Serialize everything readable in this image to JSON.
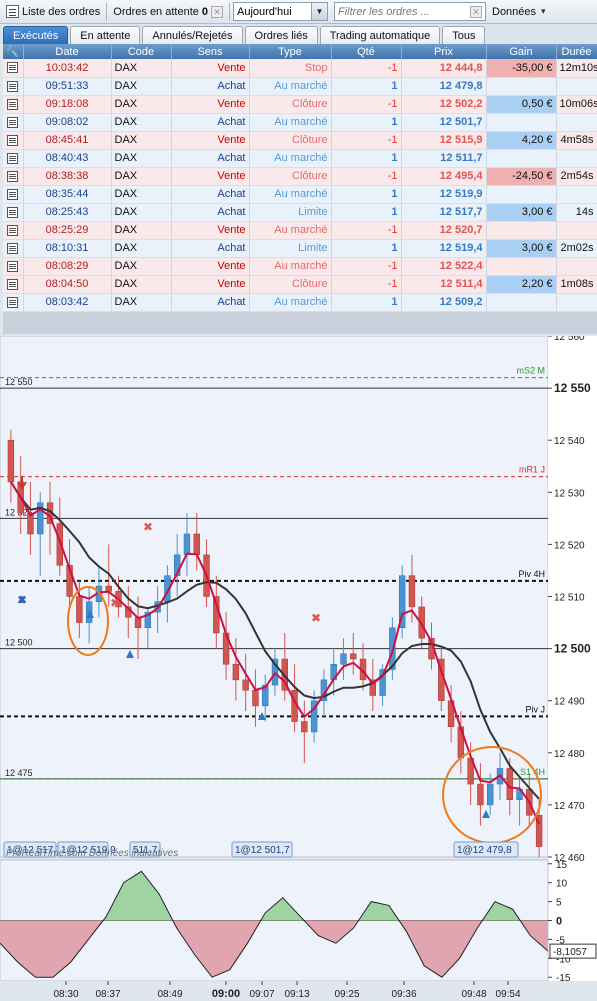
{
  "toolbar": {
    "order_list_label": "Liste des ordres",
    "pending_label": "Ordres en attente",
    "pending_count": "0",
    "period_value": "Aujourd'hui",
    "filter_placeholder": "Filtrer les ordres ...",
    "data_label": "Données"
  },
  "tabs": [
    "Exécutés",
    "En attente",
    "Annulés/Rejetés",
    "Ordres liés",
    "Trading automatique",
    "Tous"
  ],
  "columns": [
    "",
    "Date",
    "Code",
    "Sens",
    "Type",
    "Qté",
    "Prix",
    "Gain",
    "Durée"
  ],
  "orders": [
    {
      "time": "10:03:42",
      "code": "DAX",
      "side": "Vente",
      "type": "Stop",
      "qty": "-1",
      "price": "12 444,8",
      "gain": "-35,00 €",
      "duration": "12m10s",
      "dir": "sell",
      "gain_sign": "neg"
    },
    {
      "time": "09:51:33",
      "code": "DAX",
      "side": "Achat",
      "type": "Au marché",
      "qty": "1",
      "price": "12 479,8",
      "gain": "",
      "duration": "",
      "dir": "buy",
      "gain_sign": ""
    },
    {
      "time": "09:18:08",
      "code": "DAX",
      "side": "Vente",
      "type": "Clôture",
      "qty": "-1",
      "price": "12 502,2",
      "gain": "0,50 €",
      "duration": "10m06s",
      "dir": "sell",
      "gain_sign": "pos"
    },
    {
      "time": "09:08:02",
      "code": "DAX",
      "side": "Achat",
      "type": "Au marché",
      "qty": "1",
      "price": "12 501,7",
      "gain": "",
      "duration": "",
      "dir": "buy",
      "gain_sign": ""
    },
    {
      "time": "08:45:41",
      "code": "DAX",
      "side": "Vente",
      "type": "Clôture",
      "qty": "-1",
      "price": "12 515,9",
      "gain": "4,20 €",
      "duration": "4m58s",
      "dir": "sell",
      "gain_sign": "pos"
    },
    {
      "time": "08:40:43",
      "code": "DAX",
      "side": "Achat",
      "type": "Au marché",
      "qty": "1",
      "price": "12 511,7",
      "gain": "",
      "duration": "",
      "dir": "buy",
      "gain_sign": ""
    },
    {
      "time": "08:38:38",
      "code": "DAX",
      "side": "Vente",
      "type": "Clôture",
      "qty": "-1",
      "price": "12 495,4",
      "gain": "-24,50 €",
      "duration": "2m54s",
      "dir": "sell",
      "gain_sign": "neg"
    },
    {
      "time": "08:35:44",
      "code": "DAX",
      "side": "Achat",
      "type": "Au marché",
      "qty": "1",
      "price": "12 519,9",
      "gain": "",
      "duration": "",
      "dir": "buy",
      "gain_sign": ""
    },
    {
      "time": "08:25:43",
      "code": "DAX",
      "side": "Achat",
      "type": "Limite",
      "qty": "1",
      "price": "12 517,7",
      "gain": "3,00 €",
      "duration": "14s",
      "dir": "buy",
      "gain_sign": "pos"
    },
    {
      "time": "08:25:29",
      "code": "DAX",
      "side": "Vente",
      "type": "Au marché",
      "qty": "-1",
      "price": "12 520,7",
      "gain": "",
      "duration": "",
      "dir": "sell",
      "gain_sign": ""
    },
    {
      "time": "08:10:31",
      "code": "DAX",
      "side": "Achat",
      "type": "Limite",
      "qty": "1",
      "price": "12 519,4",
      "gain": "3,00 €",
      "duration": "2m02s",
      "dir": "buy",
      "gain_sign": "pos"
    },
    {
      "time": "08:08:29",
      "code": "DAX",
      "side": "Vente",
      "type": "Au marché",
      "qty": "-1",
      "price": "12 522,4",
      "gain": "",
      "duration": "",
      "dir": "sell",
      "gain_sign": ""
    },
    {
      "time": "08:04:50",
      "code": "DAX",
      "side": "Vente",
      "type": "Clôture",
      "qty": "-1",
      "price": "12 511,4",
      "gain": "2,20 €",
      "duration": "1m08s",
      "dir": "sell",
      "gain_sign": "pos"
    },
    {
      "time": "08:03:42",
      "code": "DAX",
      "side": "Achat",
      "type": "Au marché",
      "qty": "1",
      "price": "12 509,2",
      "gain": "",
      "duration": "",
      "dir": "buy",
      "gain_sign": ""
    }
  ],
  "chart_data": {
    "type": "candlestick",
    "ylim": [
      12460,
      12560
    ],
    "y_ticks": [
      "12 560",
      "12 550",
      "12 540",
      "12 530",
      "12 520",
      "12 510",
      "12 500",
      "12 490",
      "12 480",
      "12 470",
      "12 460"
    ],
    "level_lines": [
      {
        "label": "mS2 M",
        "value": 12552,
        "color": "#2a9a2a",
        "style": "dashed"
      },
      {
        "label": "12 550",
        "value": 12550,
        "color": "#333333",
        "style": "solid"
      },
      {
        "label": "mR1 J",
        "value": 12533,
        "color": "#d03030",
        "style": "dashed"
      },
      {
        "label": "12 525",
        "value": 12525,
        "color": "#333333",
        "style": "solid"
      },
      {
        "label": "Piv 4H",
        "value": 12513,
        "color": "#111111",
        "style": "dashed"
      },
      {
        "label": "12 500",
        "value": 12500,
        "color": "#333333",
        "style": "solid"
      },
      {
        "label": "Piv J",
        "value": 12487,
        "color": "#111111",
        "style": "dashed"
      },
      {
        "label": "12 475",
        "value": 12475,
        "color": "#333333",
        "style": "solid"
      },
      {
        "label": "S1 4H",
        "value": 12475,
        "color": "#2a9a2a",
        "style": "dashed"
      }
    ],
    "bold_ticks": [
      "12 550",
      "12 500"
    ],
    "x_ticks": [
      "08:30",
      "08:37",
      "08:49",
      "09:00",
      "09:07",
      "09:13",
      "09:25",
      "09:36",
      "09:48",
      "09:54"
    ],
    "trade_tags": [
      "1@12 517,7",
      "1@12 519,9",
      "511,7",
      "1@12 501,7",
      "1@12 479,8"
    ],
    "watermark": "ProRealTime.com Données indicatives",
    "candles": [
      [
        12540,
        12542,
        12528,
        12532
      ],
      [
        12532,
        12537,
        12522,
        12526
      ],
      [
        12526,
        12532,
        12518,
        12522
      ],
      [
        12522,
        12530,
        12514,
        12528
      ],
      [
        12528,
        12532,
        12518,
        12524
      ],
      [
        12524,
        12529,
        12514,
        12516
      ],
      [
        12516,
        12521,
        12508,
        12510
      ],
      [
        12510,
        12513,
        12502,
        12505
      ],
      [
        12505,
        12512,
        12501,
        12509
      ],
      [
        12509,
        12516,
        12506,
        12512
      ],
      [
        12512,
        12520,
        12508,
        12511
      ],
      [
        12511,
        12514,
        12506,
        12508
      ],
      [
        12508,
        12512,
        12502,
        12506
      ],
      [
        12506,
        12510,
        12498,
        12504
      ],
      [
        12504,
        12508,
        12500,
        12507
      ],
      [
        12507,
        12512,
        12503,
        12509
      ],
      [
        12509,
        12516,
        12505,
        12514
      ],
      [
        12514,
        12522,
        12510,
        12518
      ],
      [
        12518,
        12526,
        12514,
        12522
      ],
      [
        12522,
        12526,
        12515,
        12518
      ],
      [
        12518,
        12521,
        12508,
        12510
      ],
      [
        12510,
        12514,
        12500,
        12503
      ],
      [
        12503,
        12507,
        12494,
        12497
      ],
      [
        12497,
        12502,
        12490,
        12494
      ],
      [
        12494,
        12499,
        12488,
        12492
      ],
      [
        12492,
        12496,
        12485,
        12489
      ],
      [
        12489,
        12495,
        12486,
        12493
      ],
      [
        12493,
        12500,
        12491,
        12498
      ],
      [
        12498,
        12503,
        12490,
        12492
      ],
      [
        12492,
        12497,
        12484,
        12486
      ],
      [
        12486,
        12490,
        12478,
        12484
      ],
      [
        12484,
        12492,
        12482,
        12490
      ],
      [
        12490,
        12496,
        12487,
        12494
      ],
      [
        12494,
        12500,
        12491,
        12497
      ],
      [
        12497,
        12502,
        12494,
        12499
      ],
      [
        12499,
        12503,
        12495,
        12498
      ],
      [
        12498,
        12501,
        12492,
        12494
      ],
      [
        12494,
        12498,
        12488,
        12491
      ],
      [
        12491,
        12497,
        12489,
        12496
      ],
      [
        12496,
        12506,
        12494,
        12504
      ],
      [
        12504,
        12516,
        12502,
        12514
      ],
      [
        12514,
        12518,
        12505,
        12508
      ],
      [
        12508,
        12510,
        12500,
        12502
      ],
      [
        12502,
        12505,
        12496,
        12498
      ],
      [
        12498,
        12500,
        12488,
        12490
      ],
      [
        12490,
        12493,
        12482,
        12485
      ],
      [
        12485,
        12488,
        12476,
        12479
      ],
      [
        12479,
        12482,
        12470,
        12474
      ],
      [
        12474,
        12478,
        12466,
        12470
      ],
      [
        12470,
        12476,
        12468,
        12474
      ],
      [
        12474,
        12480,
        12471,
        12477
      ],
      [
        12477,
        12479,
        12468,
        12471
      ],
      [
        12471,
        12475,
        12466,
        12473
      ],
      [
        12473,
        12476,
        12466,
        12468
      ],
      [
        12468,
        12471,
        12460,
        12462
      ]
    ],
    "osc_values": [
      -6,
      -11,
      -15,
      -15,
      -11,
      -5,
      1,
      10,
      13,
      7,
      -2,
      -9,
      -15,
      -13,
      -6,
      2,
      6,
      1,
      -4,
      -6,
      -2,
      5,
      4,
      -3,
      -12,
      -15,
      -10,
      -2,
      5,
      3,
      -4,
      -8.1
    ]
  }
}
